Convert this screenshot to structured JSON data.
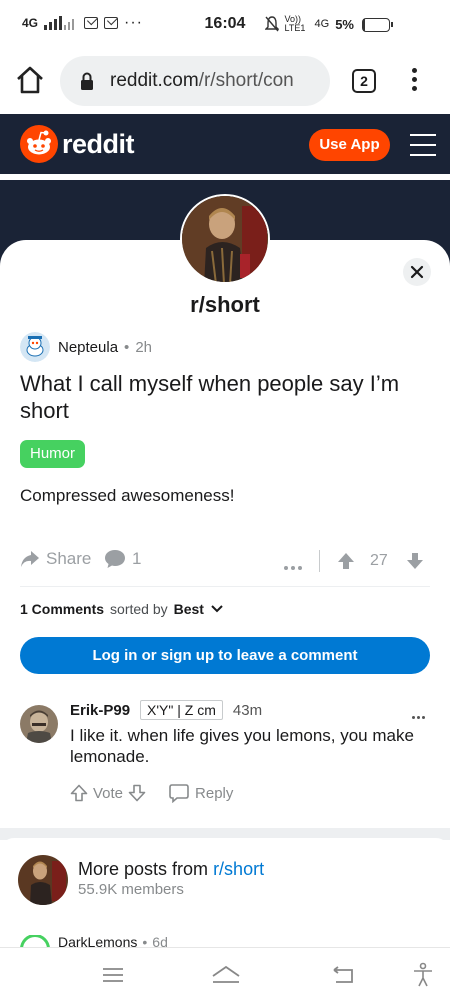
{
  "status_bar": {
    "network_left": "4G",
    "time": "16:04",
    "carrier": "Vo)) LTE1",
    "network_right": "4G",
    "battery_pct": "5%",
    "battery_level": 0.05
  },
  "browser": {
    "url_domain": "reddit.com",
    "url_path": "/r/short/con",
    "tab_count": "2"
  },
  "header": {
    "brand": "reddit",
    "use_app_label": "Use App",
    "colors": {
      "accent": "#ff4500",
      "header_bg": "#1a2336"
    }
  },
  "subreddit": {
    "name": "r/short"
  },
  "post": {
    "author": "Nepteula",
    "age": "2h",
    "title": "What I call myself when people say I’m short",
    "flair": "Humor",
    "body": "Compressed awesomeness!",
    "share_label": "Share",
    "comment_count": "1",
    "score": "27"
  },
  "comments_section": {
    "count_label": "1 Comments",
    "sorted_by_label": "sorted by",
    "sort_value": "Best",
    "login_button": "Log in or sign up to leave a comment"
  },
  "comment": {
    "author": "Erik-P99",
    "user_flair": "X'Y\" | Z cm",
    "age": "43m",
    "text": "I like it. when life gives you lemons, you make lemonade.",
    "vote_label": "Vote",
    "reply_label": "Reply"
  },
  "more_posts": {
    "prefix": "More posts from",
    "subreddit": "r/short",
    "members": "55.9K members",
    "peek_author": "DarkLemons",
    "peek_age": "6d"
  }
}
